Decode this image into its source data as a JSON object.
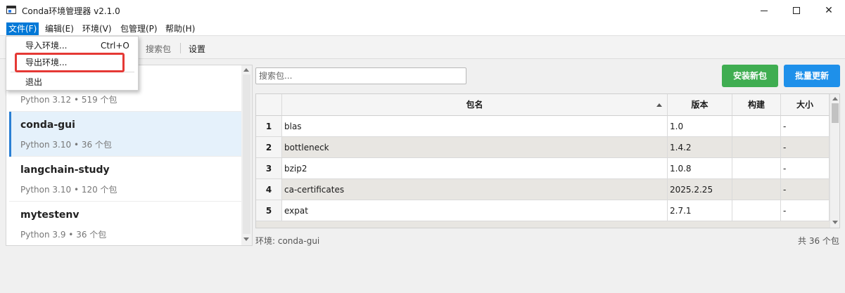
{
  "window": {
    "title": "Conda环境管理器 v2.1.0"
  },
  "menubar": {
    "items": [
      {
        "label": "文件(F)"
      },
      {
        "label": "编辑(E)"
      },
      {
        "label": "环境(V)"
      },
      {
        "label": "包管理(P)"
      },
      {
        "label": "帮助(H)"
      }
    ]
  },
  "file_menu": {
    "import_label": "导入环境...",
    "import_shortcut": "Ctrl+O",
    "export_label": "导出环境...",
    "exit_label": "退出"
  },
  "toolbar": {
    "items": [
      {
        "label": "搜索包"
      },
      {
        "label": "设置"
      }
    ]
  },
  "environments": [
    {
      "name": "",
      "info": "Python 3.12 • 519 个包"
    },
    {
      "name": "conda-gui",
      "info": "Python 3.10 • 36 个包",
      "selected": true
    },
    {
      "name": "langchain-study",
      "info": "Python 3.10 • 120 个包"
    },
    {
      "name": "mytestenv",
      "info": "Python 3.9 • 36 个包"
    }
  ],
  "search": {
    "placeholder": "搜索包..."
  },
  "buttons": {
    "install": "安装新包",
    "update": "批量更新"
  },
  "table": {
    "headers": {
      "name": "包名",
      "version": "版本",
      "build": "构建",
      "size": "大小"
    },
    "rows": [
      {
        "num": "1",
        "name": "blas",
        "version": "1.0",
        "build": "",
        "size": "-"
      },
      {
        "num": "2",
        "name": "bottleneck",
        "version": "1.4.2",
        "build": "",
        "size": "-"
      },
      {
        "num": "3",
        "name": "bzip2",
        "version": "1.0.8",
        "build": "",
        "size": "-"
      },
      {
        "num": "4",
        "name": "ca-certificates",
        "version": "2025.2.25",
        "build": "",
        "size": "-"
      },
      {
        "num": "5",
        "name": "expat",
        "version": "2.7.1",
        "build": "",
        "size": "-"
      }
    ]
  },
  "status": {
    "env": "环境: conda-gui",
    "count": "共 36 个包"
  },
  "colors": {
    "accent": "#0078d7",
    "install_button": "#3fad51",
    "update_button": "#1e90ea",
    "selection": "#e5f1fb",
    "highlight": "#e53935"
  }
}
